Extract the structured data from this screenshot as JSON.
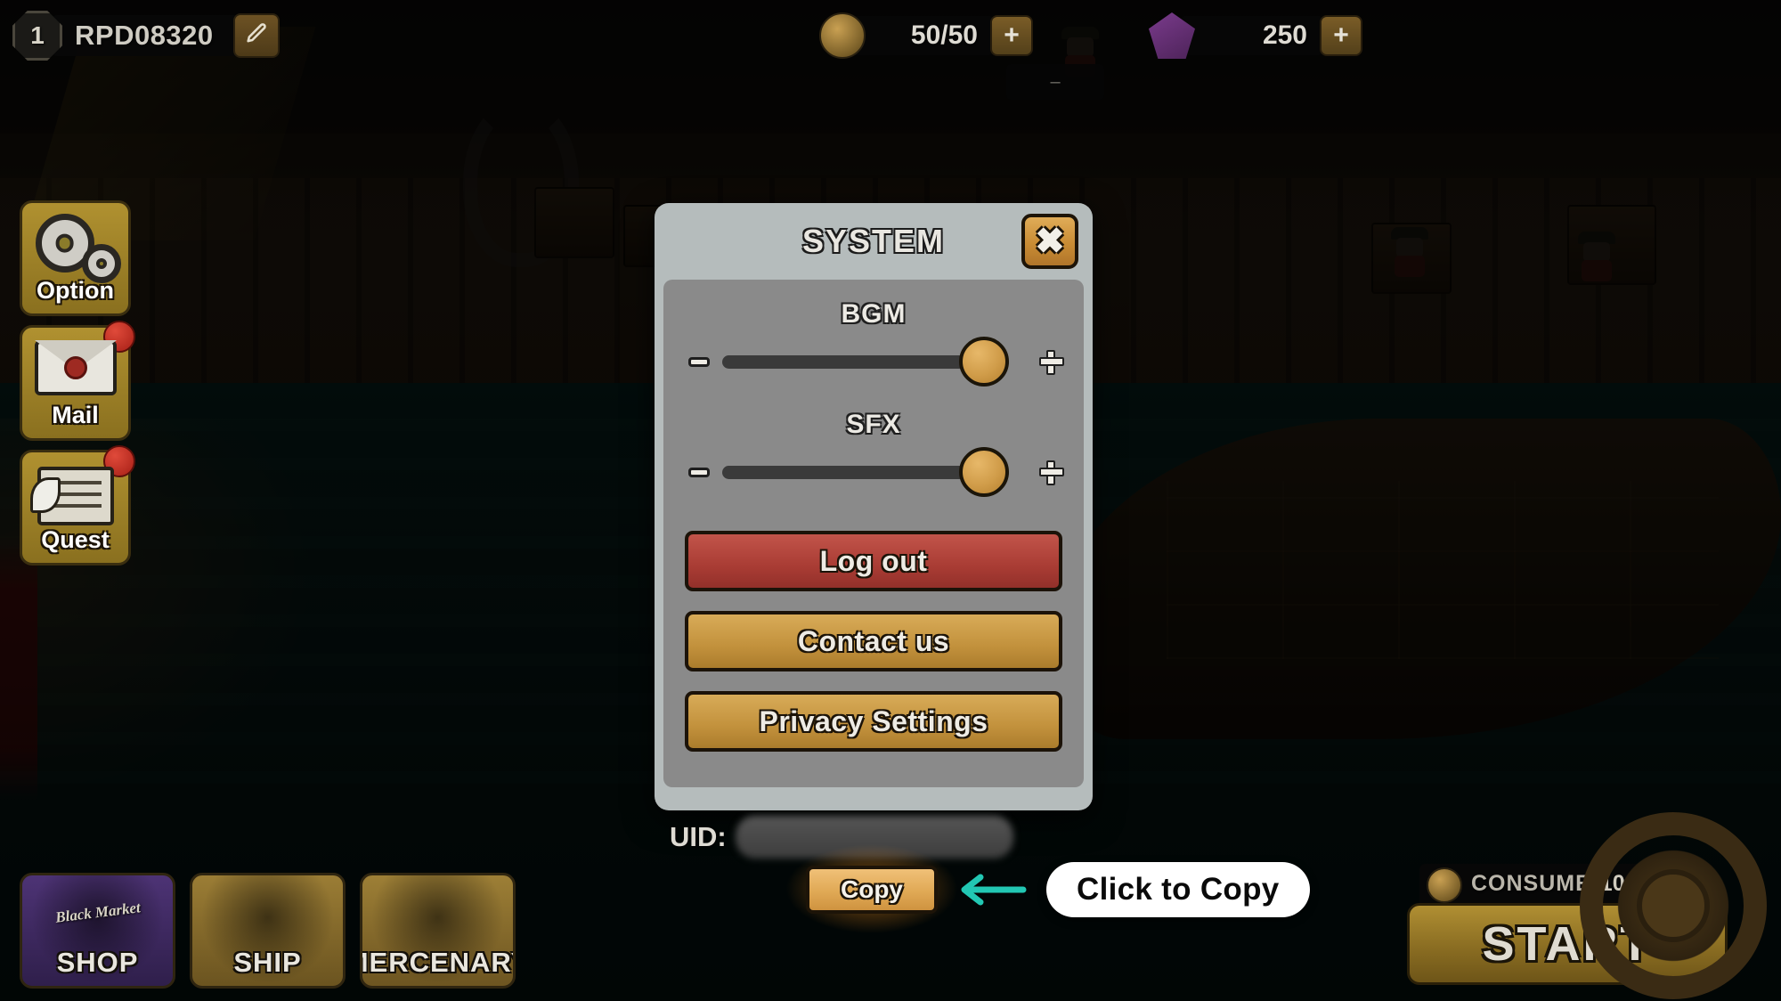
{
  "hud": {
    "player": {
      "level": "1",
      "name": "RPD08320",
      "edit_icon": "pencil-icon"
    },
    "currencies": [
      {
        "id": "energy",
        "icon": "energy-coin-icon",
        "value": "50/50",
        "plus_label": "+"
      },
      {
        "id": "gem",
        "icon": "gem-icon",
        "value": "250",
        "plus_label": "+"
      }
    ],
    "sub_chip": "–"
  },
  "sidebar": {
    "items": [
      {
        "label": "Option",
        "icon": "gears-icon",
        "badge": false
      },
      {
        "label": "Mail",
        "icon": "envelope-icon",
        "badge": true
      },
      {
        "label": "Quest",
        "icon": "quest-scroll-icon",
        "badge": true
      }
    ]
  },
  "bottom_nav": {
    "items": [
      {
        "label": "SHOP",
        "sub": "Black Market",
        "icon": "shop-icon"
      },
      {
        "label": "SHIP",
        "sub": "",
        "icon": "ship-icon"
      },
      {
        "label": "MERCENARY",
        "sub": "",
        "icon": "mercenary-icon"
      }
    ]
  },
  "start_panel": {
    "consume_label": "CONSUME",
    "consume_cost": "10",
    "consume_icon": "energy-coin-icon",
    "start_label": "START",
    "wheel_icon": "ship-wheel-icon"
  },
  "modal": {
    "title": "SYSTEM",
    "close_icon": "close-icon",
    "sliders": [
      {
        "label": "BGM",
        "value": 100,
        "min_icon": "minus-icon",
        "max_icon": "plus-icon"
      },
      {
        "label": "SFX",
        "value": 100,
        "min_icon": "minus-icon",
        "max_icon": "plus-icon"
      }
    ],
    "actions": [
      {
        "label": "Log out",
        "style": "danger"
      },
      {
        "label": "Contact us",
        "style": "gold"
      },
      {
        "label": "Privacy Settings",
        "style": "gold"
      }
    ]
  },
  "uid": {
    "label": "UID:",
    "value_hidden": true,
    "copy_label": "Copy",
    "hint_text": "Click to Copy",
    "hint_arrow_icon": "arrow-left-icon",
    "hint_arrow_color": "#22c7b3"
  },
  "colors": {
    "panel_outer": "#b5bcbc",
    "panel_inner": "#8a8a8a",
    "gold": "#d8ab58",
    "danger": "#c2544a",
    "knob": "#d09c49",
    "teal_accent": "#22c7b3"
  }
}
